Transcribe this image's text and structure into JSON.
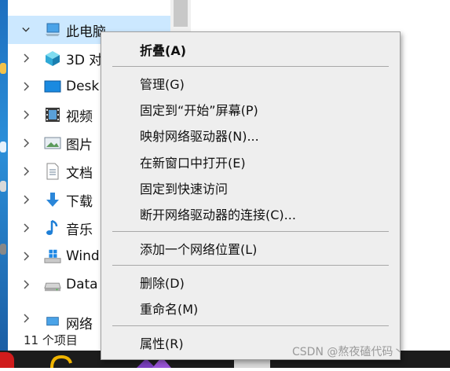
{
  "nav": {
    "items": [
      {
        "label": "此电脑",
        "icon": "computer-icon"
      },
      {
        "label": "3D 对",
        "icon": "3d-objects-icon"
      },
      {
        "label": "Desk",
        "icon": "desktop-icon"
      },
      {
        "label": "视频",
        "icon": "video-icon"
      },
      {
        "label": "图片",
        "icon": "pictures-icon"
      },
      {
        "label": "文档",
        "icon": "documents-icon"
      },
      {
        "label": "下载",
        "icon": "downloads-icon"
      },
      {
        "label": "音乐",
        "icon": "music-icon"
      },
      {
        "label": "Wind",
        "icon": "windows-drive-icon"
      },
      {
        "label": "Data",
        "icon": "data-drive-icon"
      },
      {
        "label": "网络",
        "icon": "network-icon"
      }
    ]
  },
  "status": {
    "item_count": "11 个项目"
  },
  "menu": {
    "items": [
      {
        "label": "折叠(A)"
      },
      {
        "label": "管理(G)"
      },
      {
        "label": "固定到“开始”屏幕(P)"
      },
      {
        "label": "映射网络驱动器(N)..."
      },
      {
        "label": "在新窗口中打开(E)"
      },
      {
        "label": "固定到快速访问"
      },
      {
        "label": "断开网络驱动器的连接(C)..."
      },
      {
        "label": "添加一个网络位置(L)"
      },
      {
        "label": "删除(D)"
      },
      {
        "label": "重命名(M)"
      },
      {
        "label": "属性(R)"
      }
    ]
  },
  "watermark": "CSDN @熬夜磕代码丶",
  "colors": {
    "selection": "#cce8ff",
    "menu_bg": "#eeeeee",
    "taskbar": "#1c1c1c"
  }
}
